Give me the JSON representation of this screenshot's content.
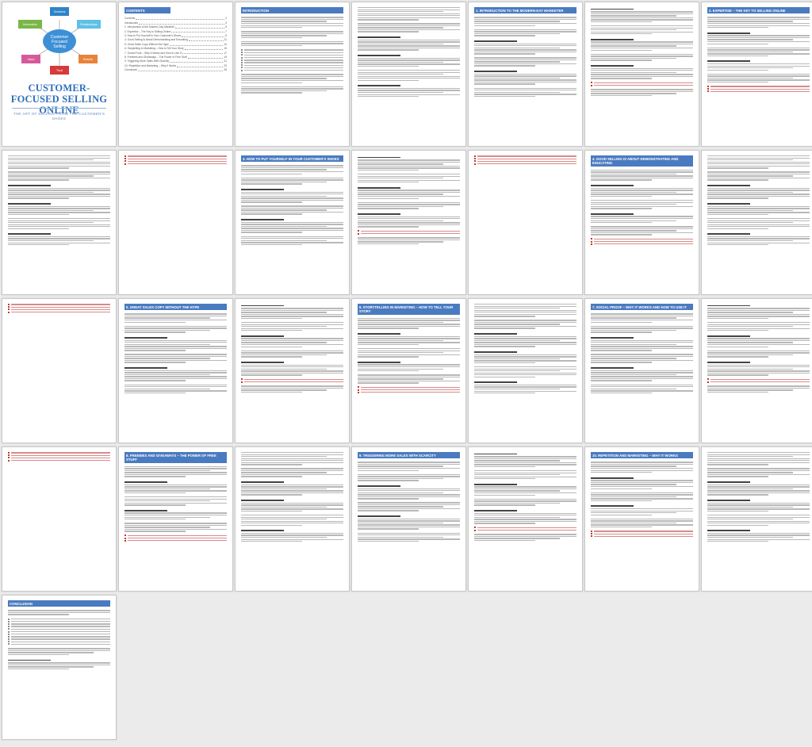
{
  "cover": {
    "title": "CUSTOMER-FOCUSED SELLING ONLINE",
    "subtitle": "THE ART OF SELLING FROM THE CUSTOMER'S SHOES",
    "hub": "Customer Focused Selling",
    "nodes": [
      "Solutions",
      "Relationships",
      "Results",
      "Trust",
      "Value",
      "Information"
    ],
    "colors": {
      "hub": "#3d8fd6",
      "solutions": "#2f83c7",
      "relationships": "#5fc0e6",
      "results": "#e8833a",
      "trust": "#d63a3a",
      "value": "#d65a9a",
      "information": "#7ab648",
      "title": "#2e6fb7",
      "heading_bar": "#4a7bc0"
    }
  },
  "toc": {
    "heading": "CONTENTS",
    "entries": [
      {
        "title": "Contents",
        "page": "2"
      },
      {
        "title": "Introduction",
        "page": "3"
      },
      {
        "title": "1. Introduction to the Modern-Day Marketer",
        "page": "5"
      },
      {
        "title": "2. Expertise – The Key to Selling Online",
        "page": "7"
      },
      {
        "title": "3. How to Put Yourself in Your Customer's Shoes",
        "page": "9"
      },
      {
        "title": "4. Good Selling Is About Demonstrating and Educating",
        "page": "11"
      },
      {
        "title": "5. Great Sales Copy Without the Hype",
        "page": "13"
      },
      {
        "title": "6. Storytelling in Marketing – How to Tell Your Story",
        "page": "15"
      },
      {
        "title": "7. Social Proof – Why It Works and How to Use It",
        "page": "17"
      },
      {
        "title": "8. Freebies and Giveaways – The Power of Free Stuff",
        "page": "19"
      },
      {
        "title": "9. Triggering More Sales With Scarcity",
        "page": "21"
      },
      {
        "title": "10. Repetition and Marketing – Why It Works",
        "page": "23"
      },
      {
        "title": "Conclusion",
        "page": "25"
      }
    ]
  },
  "headings": {
    "introduction": "INTRODUCTION",
    "ch1": "1. INTRODUCTION TO THE MODERN-DAY MARKETER",
    "ch2": "2. EXPERTISE – THE KEY TO SELLING ONLINE",
    "ch3": "3. HOW TO PUT YOURSELF IN YOUR CUSTOMER'S SHOES",
    "ch4": "4. GOOD SELLING IS ABOUT DEMONSTRATING AND EDUCATING",
    "ch5": "5. GREAT SALES COPY WITHOUT THE HYPE",
    "ch6": "6. STORYTELLING IN MARKETING – HOW TO TELL YOUR STORY",
    "ch7": "7. SOCIAL PROOF – WHY IT WORKS AND HOW TO USE IT",
    "ch8": "8. FREEBIES AND GIVEAWAYS – THE POWER OF FREE STUFF",
    "ch9": "9. TRIGGERING MORE SALES WITH SCARCITY",
    "ch10": "10. REPETITION AND MARKETING – WHY IT WORKS",
    "conclusion": "CONCLUSION"
  }
}
